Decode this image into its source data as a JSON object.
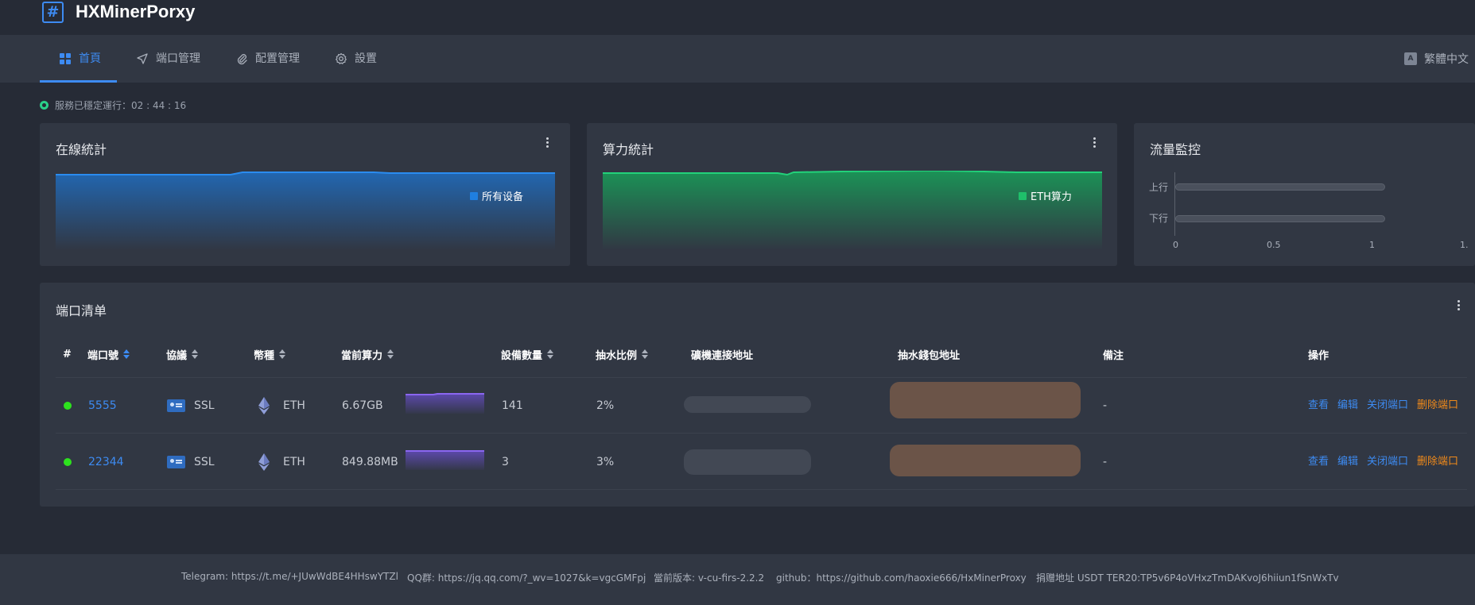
{
  "app": {
    "title": "HXMinerPorxy",
    "logo_glyph": "#"
  },
  "nav": {
    "items": [
      {
        "label": "首頁",
        "icon": "grid-icon"
      },
      {
        "label": "端口管理",
        "icon": "send-icon"
      },
      {
        "label": "配置管理",
        "icon": "paperclip-icon"
      },
      {
        "label": "設置",
        "icon": "gear-icon"
      }
    ],
    "language": "繁體中文",
    "language_icon_text": "A"
  },
  "status": {
    "text": "服務已穩定運行：02 : 44 : 16"
  },
  "cards": {
    "online": {
      "title": "在線統計",
      "legend": "所有设备",
      "color": "#1f7fe0"
    },
    "hashrate": {
      "title": "算力統計",
      "legend": "ETH算力",
      "color": "#1fbf6a"
    },
    "traffic": {
      "title": "流量監控",
      "labels": [
        "上行",
        "下行"
      ],
      "ticks": [
        "0",
        "0.5",
        "1",
        "1."
      ]
    }
  },
  "port_list": {
    "title": "端口清单",
    "headers": [
      "#",
      "端口號",
      "協議",
      "幣種",
      "當前算力",
      "設備數量",
      "抽水比例",
      "礦機連接地址",
      "抽水錢包地址",
      "備注",
      "操作"
    ],
    "rows": [
      {
        "port": "5555",
        "protocol": "SSL",
        "coin": "ETH",
        "hashrate": "6.67GB",
        "devices": "141",
        "fee": "2%",
        "note": "-"
      },
      {
        "port": "22344",
        "protocol": "SSL",
        "coin": "ETH",
        "hashrate": "849.88MB",
        "devices": "3",
        "fee": "3%",
        "note": "-"
      }
    ],
    "actions": [
      "查看",
      "编辑",
      "关闭端口",
      "删除端口"
    ]
  },
  "footer": {
    "telegram": "Telegram: https://t.me/+JUwWdBE4HHswYTZl",
    "qq": "QQ群: https://jq.qq.com/?_wv=1027&k=vgcGMFpj",
    "version": "當前版本: v-cu-firs-2.2.2",
    "github": "github：https://github.com/haoxie666/HxMinerProxy",
    "donate": "捐赠地址 USDT TER20:TP5v6P4oVHxzTmDAKvoJ6hiiun1fSnWxTv"
  }
}
